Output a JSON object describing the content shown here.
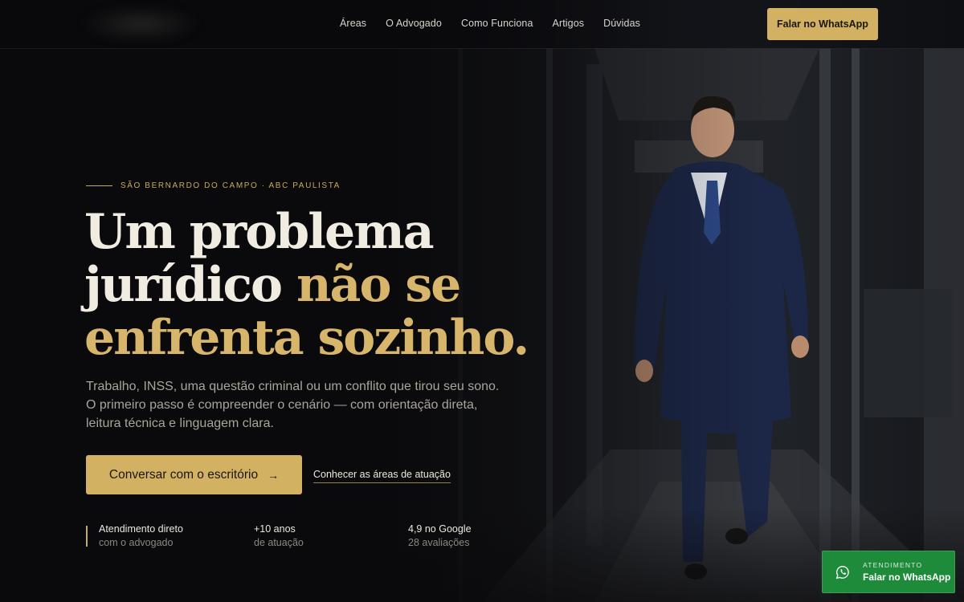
{
  "header": {
    "nav": [
      {
        "label": "Áreas"
      },
      {
        "label": "O Advogado"
      },
      {
        "label": "Como Funciona"
      },
      {
        "label": "Artigos"
      },
      {
        "label": "Dúvidas"
      }
    ],
    "cta_label": "Falar no WhatsApp"
  },
  "hero": {
    "eyebrow": "SÃO BERNARDO DO CAMPO · ABC PAULISTA",
    "headline": {
      "line1": "Um problema",
      "line2_white": "jurídico ",
      "line2_gold": "não se",
      "line3_gold": "enfrenta sozinho."
    },
    "subtext": "Trabalho, INSS, uma questão criminal ou um conflito que tirou seu sono. O primeiro passo é compreender o cenário — com orientação direta, leitura técnica e linguagem clara.",
    "primary_cta": "Conversar com o escritório",
    "primary_cta_arrow": "→",
    "secondary_cta": "Conhecer as áreas de atuação",
    "stats": [
      {
        "title": "Atendimento direto",
        "sub": "com o advogado"
      },
      {
        "title": "+10 anos",
        "sub": "de atuação"
      },
      {
        "title": "4,9 no Google",
        "sub": "28 avaliações"
      }
    ]
  },
  "whatsapp_float": {
    "label": "ATENDIMENTO",
    "value": "Falar no WhatsApp",
    "icon": "whatsapp-icon"
  },
  "colors": {
    "accent_gold": "#d2b163",
    "background": "#0d0d0f",
    "whatsapp_green": "#1e8b3a"
  }
}
